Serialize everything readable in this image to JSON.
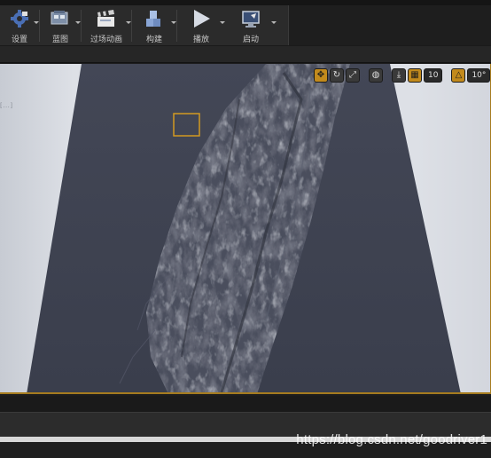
{
  "toolbar": {
    "items": [
      {
        "label": "设置",
        "icon": "settings-icon"
      },
      {
        "label": "蓝图",
        "icon": "blueprint-icon"
      },
      {
        "label": "过场动画",
        "icon": "clapperboard-icon"
      },
      {
        "label": "构建",
        "icon": "build-blocks-icon"
      },
      {
        "label": "播放",
        "icon": "play-icon"
      },
      {
        "label": "启动",
        "icon": "launch-icon"
      }
    ]
  },
  "viewport": {
    "faint_label": "[...]",
    "controls": {
      "grid_snap_value": "10",
      "rotation_snap_value": "10°",
      "accent_color": "#c28a1c"
    }
  },
  "watermark": "https://blog.csdn.net/goodriver1"
}
